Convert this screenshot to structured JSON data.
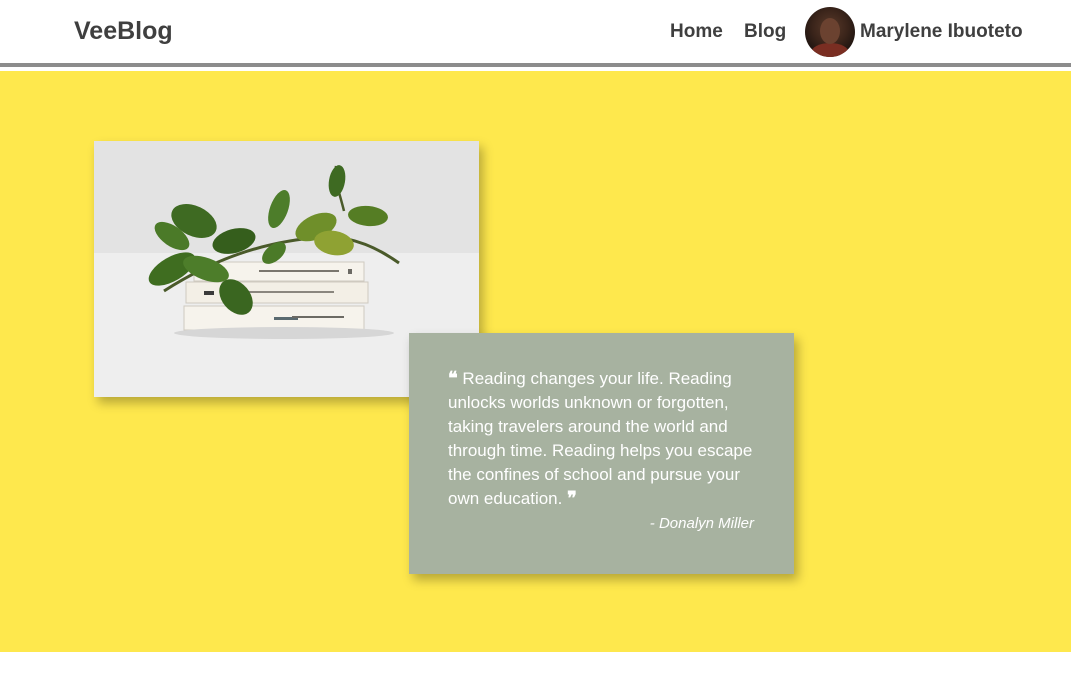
{
  "nav": {
    "brand": "VeeBlog",
    "links": [
      "Home",
      "Blog"
    ],
    "user_name": "Marylene Ibuoteto"
  },
  "hero": {
    "background_color": "#fee84d",
    "quote": {
      "open_mark": "❝",
      "text": "Reading changes your life. Reading unlocks worlds unknown or forgotten, taking travelers around the world and through time. Reading helps you escape the confines of school and pursue your own education.",
      "close_mark": "❞",
      "author": "- Donalyn Miller",
      "card_color": "#a7b2a0"
    }
  }
}
